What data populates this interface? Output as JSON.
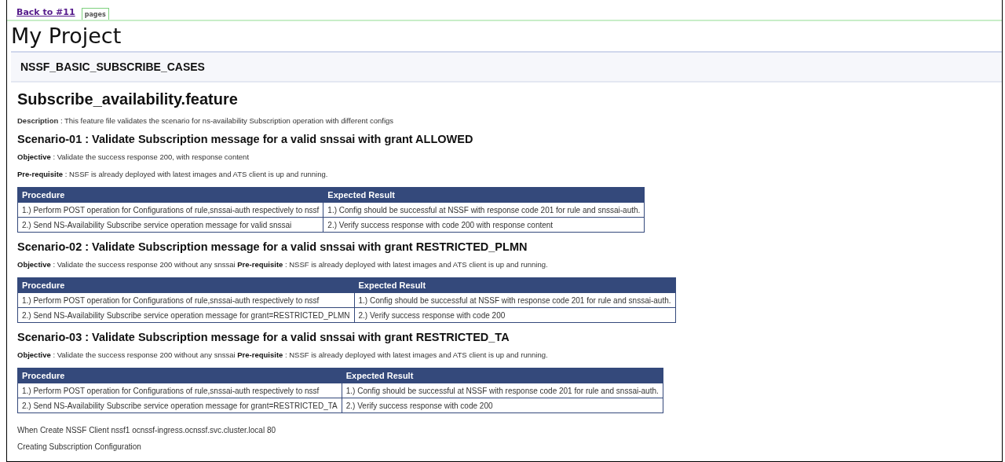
{
  "nav": {
    "back_link": "Back to #11",
    "tabs": [
      {
        "label": "pages",
        "selected": true
      }
    ]
  },
  "title": "My Project",
  "section": "NSSF_BASIC_SUBSCRIBE_CASES",
  "feature": {
    "heading": "Subscribe_availability.feature",
    "description": "**Description** : This feature file validates the scenario for ns-availability Subscription operation with different configs"
  },
  "scenarios": [
    {
      "heading": "Scenario-01 : Validate Subscription message for a valid snssai with grant ALLOWED",
      "paragraphs": [
        "**Objective** : Validate the success response 200, with response content",
        "**Pre-requisite** : NSSF is already deployed with latest images and ATS client is up and running."
      ],
      "table": {
        "columns": [
          "Procedure",
          "Expected Result"
        ],
        "rows": [
          [
            "1.) Perform POST operation for Configurations of rule,snssai-auth respectively to nssf",
            "1.) Config should be successful at NSSF with response code 201 for rule and snssai-auth."
          ],
          [
            "2.) Send NS-Availability Subscribe service operation message for valid snssai",
            "2.) Verify success response with code 200 with response content"
          ]
        ]
      }
    },
    {
      "heading": "Scenario-02 : Validate Subscription message for a valid snssai with grant RESTRICTED_PLMN",
      "paragraphs": [
        "**Objective** : Validate the success response 200 without any snssai **Pre-requisite** : NSSF is already deployed with latest images and ATS client is up and running."
      ],
      "table": {
        "columns": [
          "Procedure",
          "Expected Result"
        ],
        "rows": [
          [
            "1.) Perform POST operation for Configurations of rule,snssai-auth respectively to nssf",
            "1.) Config should be successful at NSSF with response code 201 for rule and snssai-auth."
          ],
          [
            "2.) Send NS-Availability Subscribe service operation message for grant=RESTRICTED_PLMN",
            "2.) Verify success response with code 200"
          ]
        ]
      }
    },
    {
      "heading": "Scenario-03 : Validate Subscription message for a valid snssai with grant RESTRICTED_TA",
      "paragraphs": [
        "**Objective** : Validate the success response 200 without any snssai **Pre-requisite** : NSSF is already deployed with latest images and ATS client is up and running."
      ],
      "table": {
        "columns": [
          "Procedure",
          "Expected Result"
        ],
        "rows": [
          [
            "1.) Perform POST operation for Configurations of rule,snssai-auth respectively to nssf",
            "1.) Config should be successful at NSSF with response code 201 for rule and snssai-auth."
          ],
          [
            "2.) Send NS-Availability Subscribe service operation message for grant=RESTRICTED_TA",
            "2.) Verify success response with code 200"
          ]
        ]
      }
    }
  ],
  "log_lines": [
    "When Create NSSF Client nssf1 ocnssf-ingress.ocnssf.svc.cluster.local 80",
    "Creating Subscription Configuration"
  ]
}
